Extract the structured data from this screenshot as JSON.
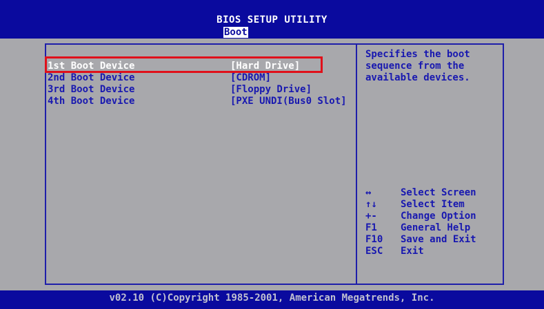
{
  "header": {
    "title": "BIOS SETUP UTILITY",
    "active_tab": "Boot"
  },
  "boot_devices": [
    {
      "label": "1st Boot Device",
      "value": "[Hard Drive]"
    },
    {
      "label": "2nd Boot Device",
      "value": "[CDROM]"
    },
    {
      "label": "3rd Boot Device",
      "value": "[Floppy Drive]"
    },
    {
      "label": "4th Boot Device",
      "value": "[PXE UNDI(Bus0 Slot]"
    }
  ],
  "help_text": "Specifies the boot\nsequence from the\navailable devices.",
  "key_legend": [
    {
      "key": "↔",
      "desc": "Select Screen"
    },
    {
      "key": "↑↓",
      "desc": "Select Item"
    },
    {
      "key": "+-",
      "desc": "Change Option"
    },
    {
      "key": "F1",
      "desc": "General Help"
    },
    {
      "key": "F10",
      "desc": "Save and Exit"
    },
    {
      "key": "ESC",
      "desc": "Exit"
    }
  ],
  "footer": {
    "text": "v02.10 (C)Copyright 1985-2001, American Megatrends, Inc."
  },
  "colors": {
    "background": "#a8a8ac",
    "bar_blue": "#0a0a9e",
    "text_blue": "#1818b0",
    "highlight_red": "#e0101a"
  }
}
